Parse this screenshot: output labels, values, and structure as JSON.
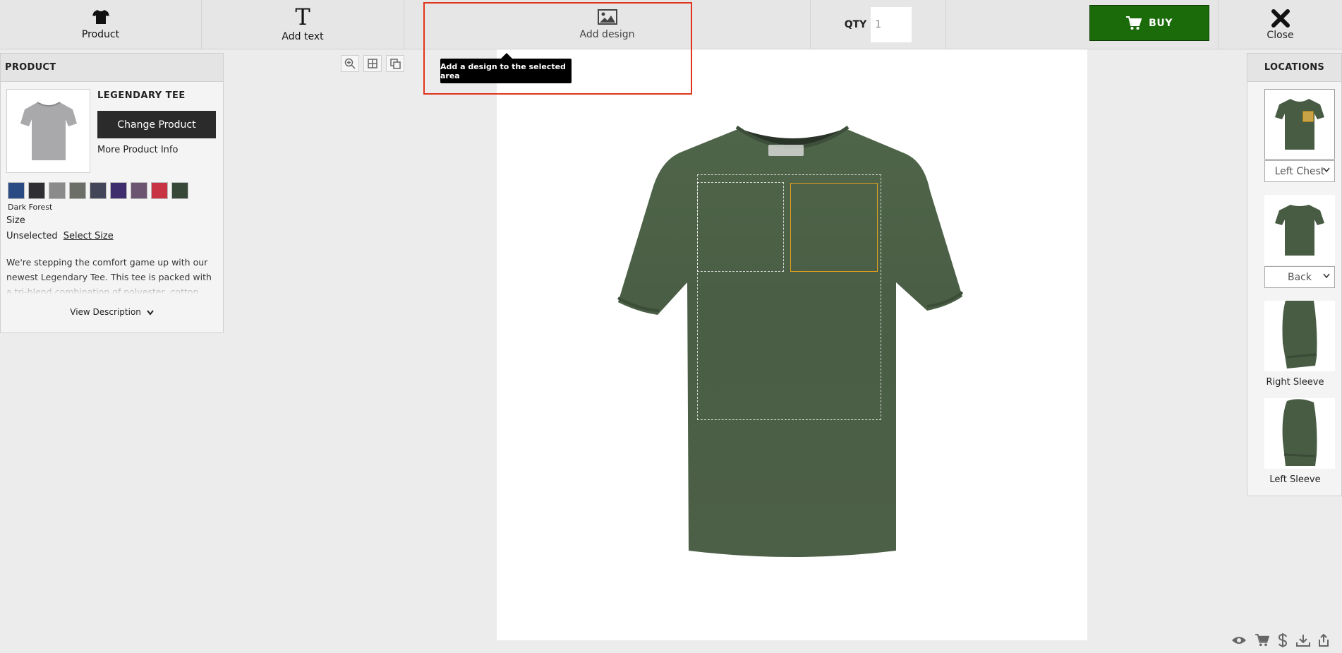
{
  "toolbar": {
    "product_label": "Product",
    "text_label": "Add text",
    "text_icon_letter": "T",
    "design_label": "Add design",
    "qty_label": "QTY",
    "qty_value": "1",
    "buy_label": "BUY",
    "close_label": "Close"
  },
  "tooltip": {
    "text": "Add a design to the selected area"
  },
  "product_panel": {
    "header": "PRODUCT",
    "name": "LEGENDARY TEE",
    "change_button": "Change Product",
    "more_info": "More Product Info",
    "swatches": [
      "#2a4a84",
      "#2e2e33",
      "#8a8a8a",
      "#6b6f68",
      "#434558",
      "#3f2e6e",
      "#6b5570",
      "#c93445",
      "#364838"
    ],
    "selected_color": "Dark Forest",
    "size_label": "Size",
    "size_value": "Unselected",
    "select_size_link": "Select Size",
    "description": "We're stepping the comfort game up with our newest Legendary Tee. This tee is packed with a tri-blend combination of polyester, cotton, and",
    "view_description": "View Description"
  },
  "locations_panel": {
    "header": "LOCATIONS",
    "items": [
      {
        "name": "Left Chest",
        "control": "select"
      },
      {
        "name": "Back",
        "control": "select"
      },
      {
        "name": "Right Sleeve",
        "control": "label"
      },
      {
        "name": "Left Sleeve",
        "control": "label"
      }
    ]
  },
  "colors": {
    "shirt": "#4a5e45",
    "buy": "#1c6b0b",
    "highlight": "#e0341c",
    "selected_area": "#e6a11a"
  }
}
